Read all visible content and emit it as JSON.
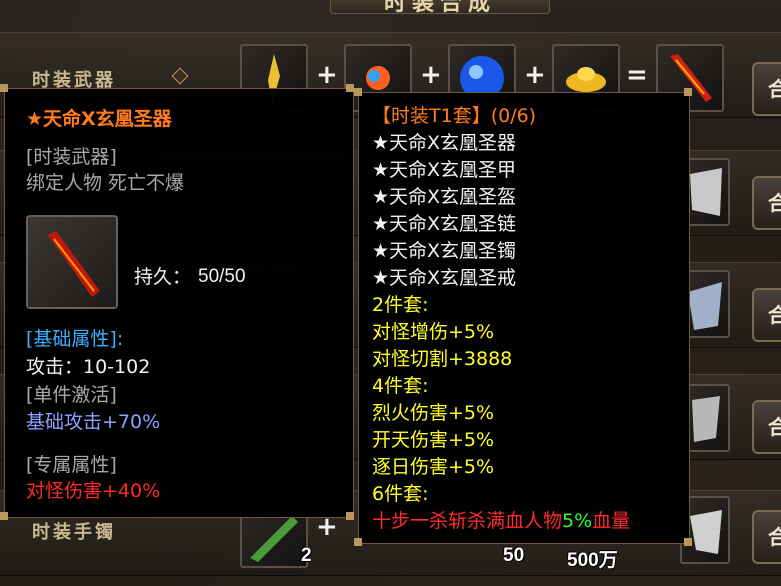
{
  "banner": {
    "title": "时装合成"
  },
  "rows": [
    {
      "label": "时装武器"
    },
    {
      "label": "时装手镯"
    }
  ],
  "recipe": {
    "plus": "+",
    "equals": "="
  },
  "side_button_label": "合",
  "bottom_counts": [
    "2",
    "50",
    "500万"
  ],
  "item_tooltip": {
    "name": "★天命X玄凰圣器",
    "type": "[时装武器]",
    "binding": "绑定人物 死亡不爆",
    "durability_label": "持久：",
    "durability_value": "50/50",
    "base_header": "[基础属性]:",
    "attack": "攻击：10-102",
    "single_header": "[单件激活]",
    "single_bonus": "基础攻击+70%",
    "exclusive_header": "[专属属性]",
    "exclusive_bonus": "对怪伤害+40%"
  },
  "set_tooltip": {
    "header": "【时装T1套】(0/6)",
    "pieces": [
      "★天命X玄凰圣器",
      "★天命X玄凰圣甲",
      "★天命X玄凰圣盔",
      "★天命X玄凰圣链",
      "★天命X玄凰圣镯",
      "★天命X玄凰圣戒"
    ],
    "tier2_header": "2件套:",
    "tier2_bonuses": [
      "对怪增伤+5%",
      "对怪切割+3888"
    ],
    "tier4_header": "4件套:",
    "tier4_bonuses": [
      "烈火伤害+5%",
      "开天伤害+5%",
      "逐日伤害+5%"
    ],
    "tier6_header": "6件套:",
    "tier6_bonus_prefix": "十步一杀斩杀满血人物",
    "tier6_bonus_pct": "5%",
    "tier6_bonus_suffix": "血量"
  },
  "colors": {
    "name_orange": "#ff7b1c",
    "set_yellow": "#ffff2a",
    "bonus_red": "#ff2a2a",
    "base_blue": "#3ab0ff",
    "pct_green": "#2aff2a"
  }
}
